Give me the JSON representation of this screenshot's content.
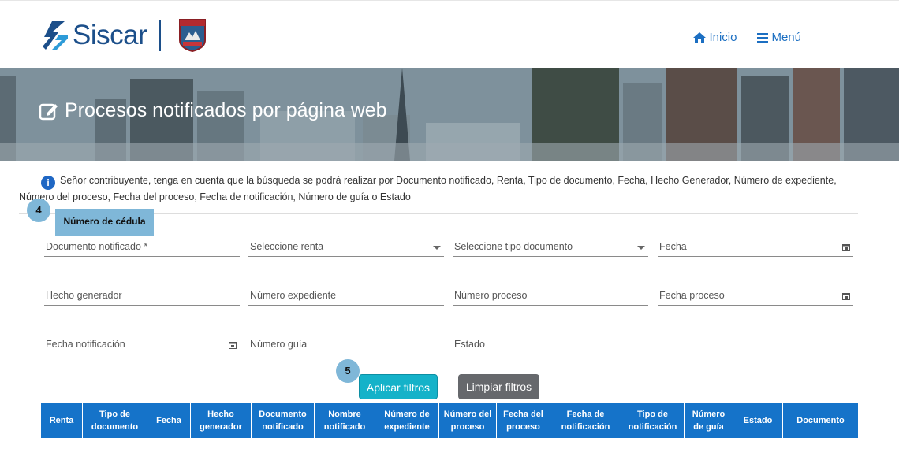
{
  "header": {
    "brand": "Siscar",
    "nav": [
      {
        "label": "Inicio",
        "icon": "home-icon"
      },
      {
        "label": "Menú",
        "icon": "hamburger-icon"
      }
    ]
  },
  "banner": {
    "title": "Procesos notificados por página web",
    "icon": "edit-icon"
  },
  "info": {
    "icon": "info-icon",
    "text": "Señor contribuyente, tenga en cuenta que la búsqueda se podrá realizar por Documento notificado, Renta, Tipo de documento, Fecha, Hecho Generador, Número de expediente, Número del proceso, Fecha del proceso, Fecha de notificación, Número de guía o Estado"
  },
  "steps": {
    "step4": "4",
    "step4_label": "Número de cédula",
    "step5": "5"
  },
  "form": {
    "documento": "Documento notificado *",
    "renta": "Seleccione renta",
    "tipo_documento": "Seleccione tipo documento",
    "fecha": "Fecha",
    "hecho_generador": "Hecho generador",
    "numero_expediente": "Número expediente",
    "numero_proceso": "Número proceso",
    "fecha_proceso": "Fecha proceso",
    "fecha_notificacion": "Fecha notificación",
    "numero_guia": "Número guía",
    "estado": "Estado"
  },
  "buttons": {
    "apply": "Aplicar filtros",
    "clear": "Limpiar filtros"
  },
  "table": {
    "columns": [
      [
        "Renta"
      ],
      [
        "Tipo de",
        "documento"
      ],
      [
        "Fecha"
      ],
      [
        "Hecho",
        "generador"
      ],
      [
        "Documento",
        "notificado"
      ],
      [
        "Nombre",
        "notificado"
      ],
      [
        "Número de",
        "expediente"
      ],
      [
        "Número del",
        "proceso"
      ],
      [
        "Fecha del",
        "proceso"
      ],
      [
        "Fecha de",
        "notificación"
      ],
      [
        "Tipo de",
        "notificación"
      ],
      [
        "Número",
        "de guía"
      ],
      [
        "Estado"
      ],
      [
        "Documento"
      ]
    ]
  },
  "colors": {
    "primary": "#1573c9",
    "brand": "#1c4f8a",
    "apply_button": "#15b2c9",
    "clear_button": "#66686c",
    "step_badge": "#7fb7d8"
  }
}
